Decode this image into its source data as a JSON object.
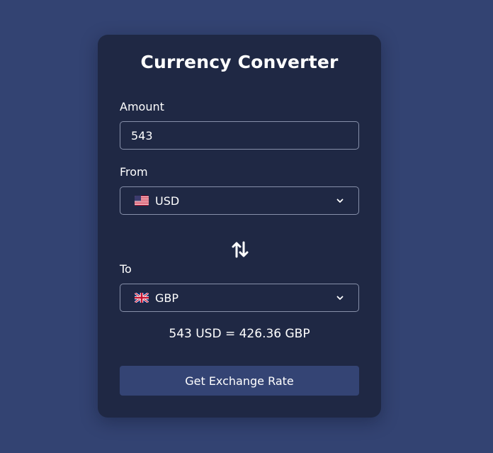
{
  "converter": {
    "title": "Currency Converter",
    "amount_label": "Amount",
    "amount_value": "543",
    "from_label": "From",
    "from_currency": "USD",
    "from_flag": "us-flag-icon",
    "to_label": "To",
    "to_currency": "GBP",
    "to_flag": "uk-flag-icon",
    "swap_icon": "swap-arrows-icon",
    "result": "543 USD = 426.36 GBP",
    "button_label": "Get Exchange Rate"
  },
  "colors": {
    "background": "#334372",
    "card": "#1f2844",
    "button": "#344474",
    "border": "#8790aa",
    "text": "#ffffff"
  }
}
